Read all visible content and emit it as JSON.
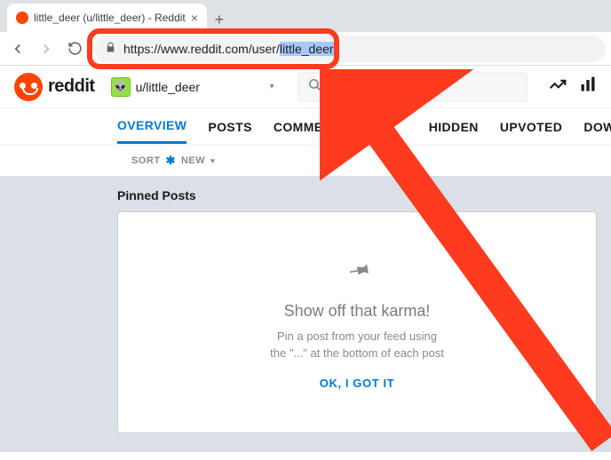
{
  "browser": {
    "tab_title": "little_deer (u/little_deer) - Reddit",
    "url_plain": "https://www.reddit.com/user/",
    "url_selected": "little_deer"
  },
  "header": {
    "brand": "reddit",
    "username": "u/little_deer",
    "search_placeholder": "Search"
  },
  "tabs": {
    "overview": "OVERVIEW",
    "posts": "POSTS",
    "comments": "COMMENTS",
    "hidden": "HIDDEN",
    "upvoted": "UPVOTED",
    "downvoted": "DOWNVOTED"
  },
  "sort": {
    "label": "SORT",
    "value": "NEW"
  },
  "pinned": {
    "section_title": "Pinned Posts",
    "heading": "Show off that karma!",
    "line1": "Pin a post from your feed using",
    "line2": "the \"...\" at the bottom of each post",
    "button": "OK, I GOT IT"
  }
}
